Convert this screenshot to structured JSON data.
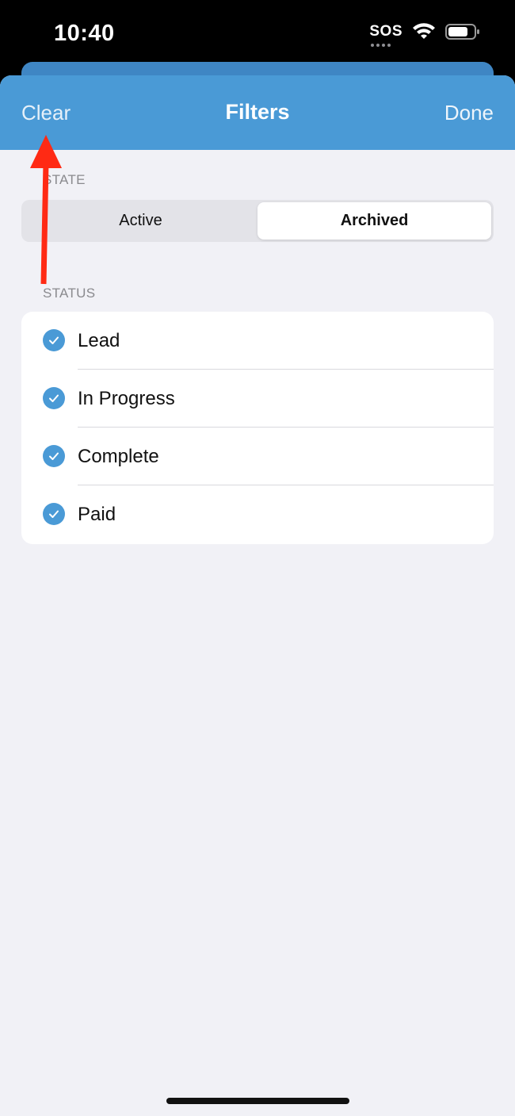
{
  "status_bar": {
    "time": "10:40",
    "sos": "SOS"
  },
  "nav": {
    "clear_label": "Clear",
    "title": "Filters",
    "done_label": "Done"
  },
  "state": {
    "section_label": "STATE",
    "options": [
      "Active",
      "Archived"
    ],
    "selected": "Archived"
  },
  "status": {
    "section_label": "STATUS",
    "items": [
      {
        "label": "Lead",
        "checked": true
      },
      {
        "label": "In Progress",
        "checked": true
      },
      {
        "label": "Complete",
        "checked": true
      },
      {
        "label": "Paid",
        "checked": true
      }
    ]
  },
  "colors": {
    "accent": "#4a9ad6",
    "annotation_arrow": "#ff2a14"
  }
}
